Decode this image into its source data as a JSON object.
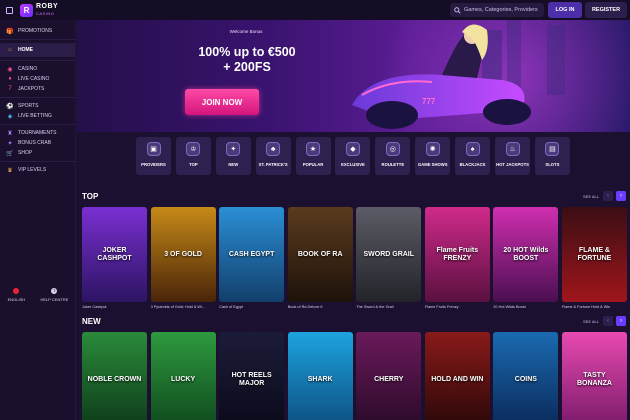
{
  "header": {
    "logo_top": "ROBY",
    "logo_bottom": "CASINO",
    "search_placeholder": "Games, Categories, Providers",
    "login_label": "LOG IN",
    "register_label": "REGISTER"
  },
  "sidebar": {
    "items": [
      {
        "label": "PROMOTIONS",
        "icon": "gift-icon"
      },
      {
        "label": "HOME",
        "icon": "home-icon"
      },
      {
        "label": "CASINO",
        "icon": "chip-icon"
      },
      {
        "label": "LIVE CASINO",
        "icon": "live-icon"
      },
      {
        "label": "JACKPOTS",
        "icon": "seven-icon"
      },
      {
        "label": "SPORTS",
        "icon": "ball-icon"
      },
      {
        "label": "LIVE BETTING",
        "icon": "live-bet-icon"
      },
      {
        "label": "TOURNAMENTS",
        "icon": "trophy-icon"
      },
      {
        "label": "BONUS CRAB",
        "icon": "crab-icon"
      },
      {
        "label": "SHOP",
        "icon": "cart-icon"
      },
      {
        "label": "VIP LEVELS",
        "icon": "crown-icon"
      }
    ],
    "language": "ENGLISH",
    "help": "HELP CENTRE"
  },
  "hero": {
    "bonus_label": "Welcome Bonus",
    "title_line1": "100% up to €500",
    "title_line2": "+ 200FS",
    "cta": "JOIN NOW"
  },
  "categories": [
    {
      "label": "PROVIDERS",
      "icon": "providers-icon"
    },
    {
      "label": "TOP",
      "icon": "top-icon"
    },
    {
      "label": "NEW",
      "icon": "new-icon"
    },
    {
      "label": "ST. PATRICK'S",
      "icon": "clover-icon"
    },
    {
      "label": "POPULAR",
      "icon": "star-icon"
    },
    {
      "label": "EXCLUSIVE",
      "icon": "diamond-icon"
    },
    {
      "label": "ROULETTE",
      "icon": "roulette-icon"
    },
    {
      "label": "GAME SHOWS",
      "icon": "gameshow-icon"
    },
    {
      "label": "BLACKJACK",
      "icon": "spade-icon"
    },
    {
      "label": "HOT JACKPOTS",
      "icon": "flame-icon"
    },
    {
      "label": "SLOTS",
      "icon": "slots-icon"
    }
  ],
  "top_section": {
    "title": "TOP",
    "see_all": "SEE ALL",
    "games": [
      {
        "title": "Joker Cashpot",
        "art": "JOKER CASHPOT",
        "color1": "#7a2fd1",
        "color2": "#2c1463",
        "new": false
      },
      {
        "title": "3 Pyramids of Gold: Hold & Wi...",
        "art": "3 OF GOLD",
        "color1": "#c68a18",
        "color2": "#4a2408",
        "new": true
      },
      {
        "title": "Cash of Egypt",
        "art": "CASH EGYPT",
        "color1": "#2b8fd6",
        "color2": "#123f6b",
        "new": true
      },
      {
        "title": "Book of Ra Deluxe 6",
        "art": "BOOK OF RA",
        "color1": "#5a3b1e",
        "color2": "#1e120a",
        "new": false
      },
      {
        "title": "The Sword & the Grail",
        "art": "SWORD GRAIL",
        "color1": "#5c5c66",
        "color2": "#23232a",
        "new": false
      },
      {
        "title": "Flame Fruits Frenzy",
        "art": "Flame Fruits FRENZY",
        "color1": "#d02a8a",
        "color2": "#5a1040",
        "new": true
      },
      {
        "title": "20 Hot Wilds Boost",
        "art": "20 HOT Wilds BOOST",
        "color1": "#d02eb0",
        "color2": "#4a0f50",
        "new": true
      },
      {
        "title": "Flame & Fortune Hold & Win",
        "art": "FLAME & FORTUNE",
        "color1": "#3a0e14",
        "color2": "#a0161c",
        "new": true
      }
    ]
  },
  "new_section": {
    "title": "NEW",
    "see_all": "SEE ALL",
    "games": [
      {
        "art": "NOBLE CROWN",
        "color1": "#2a8a3a",
        "color2": "#0e3c1a",
        "new": true
      },
      {
        "art": "LUCKY",
        "color1": "#2e9a3e",
        "color2": "#0f4a1e",
        "new": true
      },
      {
        "art": "HOT REELS MAJOR",
        "color1": "#1c1c3a",
        "color2": "#0a0a1a",
        "new": true
      },
      {
        "art": "SHARK",
        "color1": "#1ea3e0",
        "color2": "#0c4f80",
        "new": true
      },
      {
        "art": "CHERRY",
        "color1": "#6a1a5a",
        "color2": "#2a0a2a",
        "new": true
      },
      {
        "art": "HOLD AND WIN",
        "color1": "#8a1a1a",
        "color2": "#2a0808",
        "new": true
      },
      {
        "art": "COINS",
        "color1": "#1a6ab0",
        "color2": "#0a2a5a",
        "new": true
      },
      {
        "art": "TASTY BONANZA",
        "color1": "#e84ab0",
        "color2": "#7a1a6a",
        "new": true
      }
    ]
  }
}
